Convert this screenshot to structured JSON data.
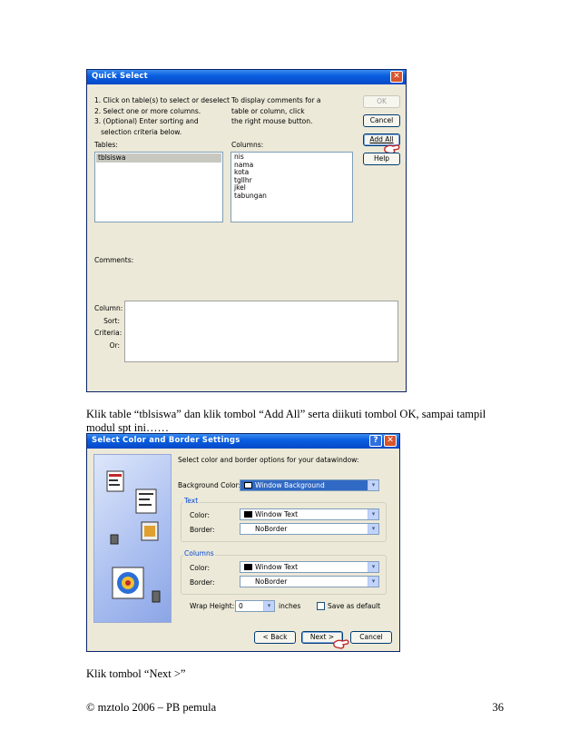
{
  "quick_select": {
    "title": "Quick Select",
    "close_glyph": "✕",
    "instructions_left": [
      "1. Click on table(s) to select or deselect",
      "2. Select one or more columns.",
      "3. (Optional) Enter sorting and",
      "   selection criteria below."
    ],
    "instructions_right": [
      "To display comments for a",
      "table or column, click",
      "the right mouse button."
    ],
    "tables_label": "Tables:",
    "tables": [
      "tblsiswa"
    ],
    "columns_label": "Columns:",
    "columns": [
      "nis",
      "nama",
      "kota",
      "tgllhr",
      "jkel",
      "tabungan"
    ],
    "buttons": {
      "ok": "OK",
      "cancel": "Cancel",
      "add_all": "Add All",
      "help": "Help"
    },
    "comments_label": "Comments:",
    "grid_labels": [
      "Column:",
      "Sort:",
      "Criteria:",
      "Or:"
    ]
  },
  "caption1_line1": "Klik table “tblsiswa” dan klik tombol “Add All” serta diikuti tombol OK, sampai tampil",
  "caption1_line2": "modul spt ini……",
  "color_border": {
    "title": "Select Color and Border Settings",
    "help_glyph": "?",
    "close_glyph": "✕",
    "intro": "Select color and border options for your datawindow:",
    "background_label": "Background Color:",
    "background_value": "Window Background",
    "text_group": "Text",
    "columns_group": "Columns",
    "color_label": "Color:",
    "border_label": "Border:",
    "text_color": "Window Text",
    "text_border": "NoBorder",
    "col_color": "Window Text",
    "col_border": "NoBorder",
    "wrap_label": "Wrap Height:",
    "wrap_value": "0",
    "wrap_unit": "inches",
    "save_default": "Save as default",
    "buttons": {
      "back": "< Back",
      "next": "Next >",
      "cancel": "Cancel"
    },
    "dropdown_glyph": "▾"
  },
  "caption2": "Klik tombol “Next >”",
  "footer_left": "© mztolo 2006 – PB pemula",
  "footer_right": "36",
  "colors": {
    "xp_face": "#ECE9D8",
    "xp_title": "#0A5FE0",
    "xp_close": "#D8542C",
    "selection": "#C8C8C0"
  }
}
